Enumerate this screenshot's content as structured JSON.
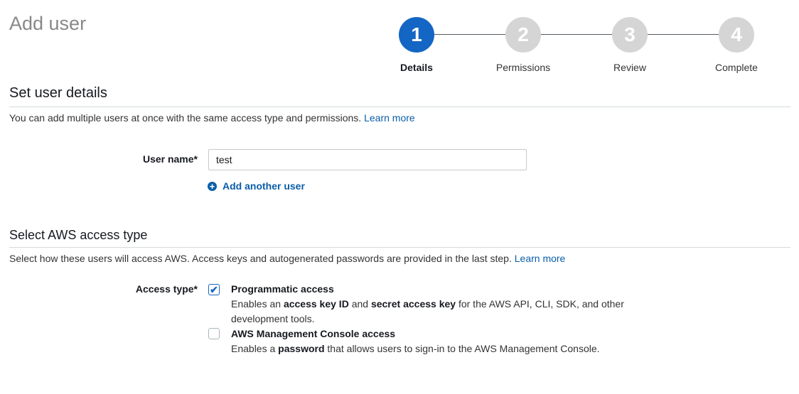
{
  "page": {
    "title": "Add user"
  },
  "steps": [
    {
      "number": "1",
      "label": "Details",
      "active": true
    },
    {
      "number": "2",
      "label": "Permissions",
      "active": false
    },
    {
      "number": "3",
      "label": "Review",
      "active": false
    },
    {
      "number": "4",
      "label": "Complete",
      "active": false
    }
  ],
  "user_details": {
    "title": "Set user details",
    "description": "You can add multiple users at once with the same access type and permissions.",
    "learn_more": "Learn more",
    "user_name_label": "User name*",
    "user_name_value": "test",
    "add_another_label": "Add another user"
  },
  "access_type": {
    "title": "Select AWS access type",
    "description": "Select how these users will access AWS. Access keys and autogenerated passwords are provided in the last step.",
    "learn_more": "Learn more",
    "label": "Access type*",
    "options": [
      {
        "title": "Programmatic access",
        "checked": true,
        "desc_1": "Enables an ",
        "bold_1": "access key ID",
        "desc_2": " and ",
        "bold_2": "secret access key",
        "desc_3": " for the AWS API, CLI, SDK, and other development tools."
      },
      {
        "title": "AWS Management Console access",
        "checked": false,
        "desc_1": "Enables a ",
        "bold_1": "password",
        "desc_2": " that allows users to sign-in to the AWS Management Console."
      }
    ]
  },
  "colors": {
    "accent": "#1466c4",
    "link": "#0a5ea8",
    "step_inactive": "#d5d5d5"
  }
}
